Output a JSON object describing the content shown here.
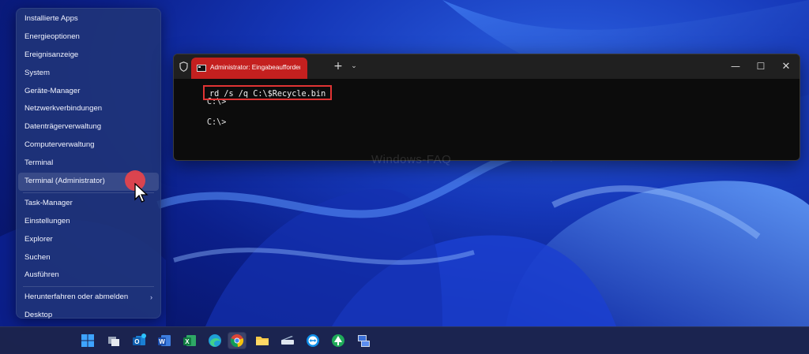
{
  "start_menu": {
    "items": [
      {
        "label": "Installierte Apps"
      },
      {
        "label": "Energieoptionen"
      },
      {
        "label": "Ereignisanzeige"
      },
      {
        "label": "System"
      },
      {
        "label": "Geräte-Manager"
      },
      {
        "label": "Netzwerkverbindungen"
      },
      {
        "label": "Datenträgerverwaltung"
      },
      {
        "label": "Computerverwaltung"
      },
      {
        "label": "Terminal"
      },
      {
        "label": "Terminal (Administrator)"
      },
      {
        "label": "Task-Manager"
      },
      {
        "label": "Einstellungen"
      },
      {
        "label": "Explorer"
      },
      {
        "label": "Suchen"
      },
      {
        "label": "Ausführen"
      },
      {
        "label": "Herunterfahren oder abmelden"
      },
      {
        "label": "Desktop"
      }
    ],
    "hovered_item": "Terminal (Administrator)",
    "chevron": "›"
  },
  "terminal": {
    "tab_title": "Administrator: Eingabeaufforderung",
    "new_tab_symbol": "+",
    "dropdown_symbol": "⌄",
    "min_symbol": "—",
    "max_symbol": "☐",
    "close_symbol": "✕",
    "prompt": "C:\\>",
    "command": "rd /s /q C:\\$Recycle.bin",
    "highlight_color": "#e03434"
  },
  "watermark": "Windows-FAQ",
  "taskbar": {
    "icons": [
      "windows-start-icon",
      "task-view-icon",
      "outlook-icon",
      "word-icon",
      "excel-icon",
      "edge-icon",
      "chrome-icon",
      "file-explorer-icon",
      "scanner-icon",
      "teamviewer-icon",
      "tree-app-icon",
      "network-icon"
    ],
    "active": "chrome-icon"
  }
}
